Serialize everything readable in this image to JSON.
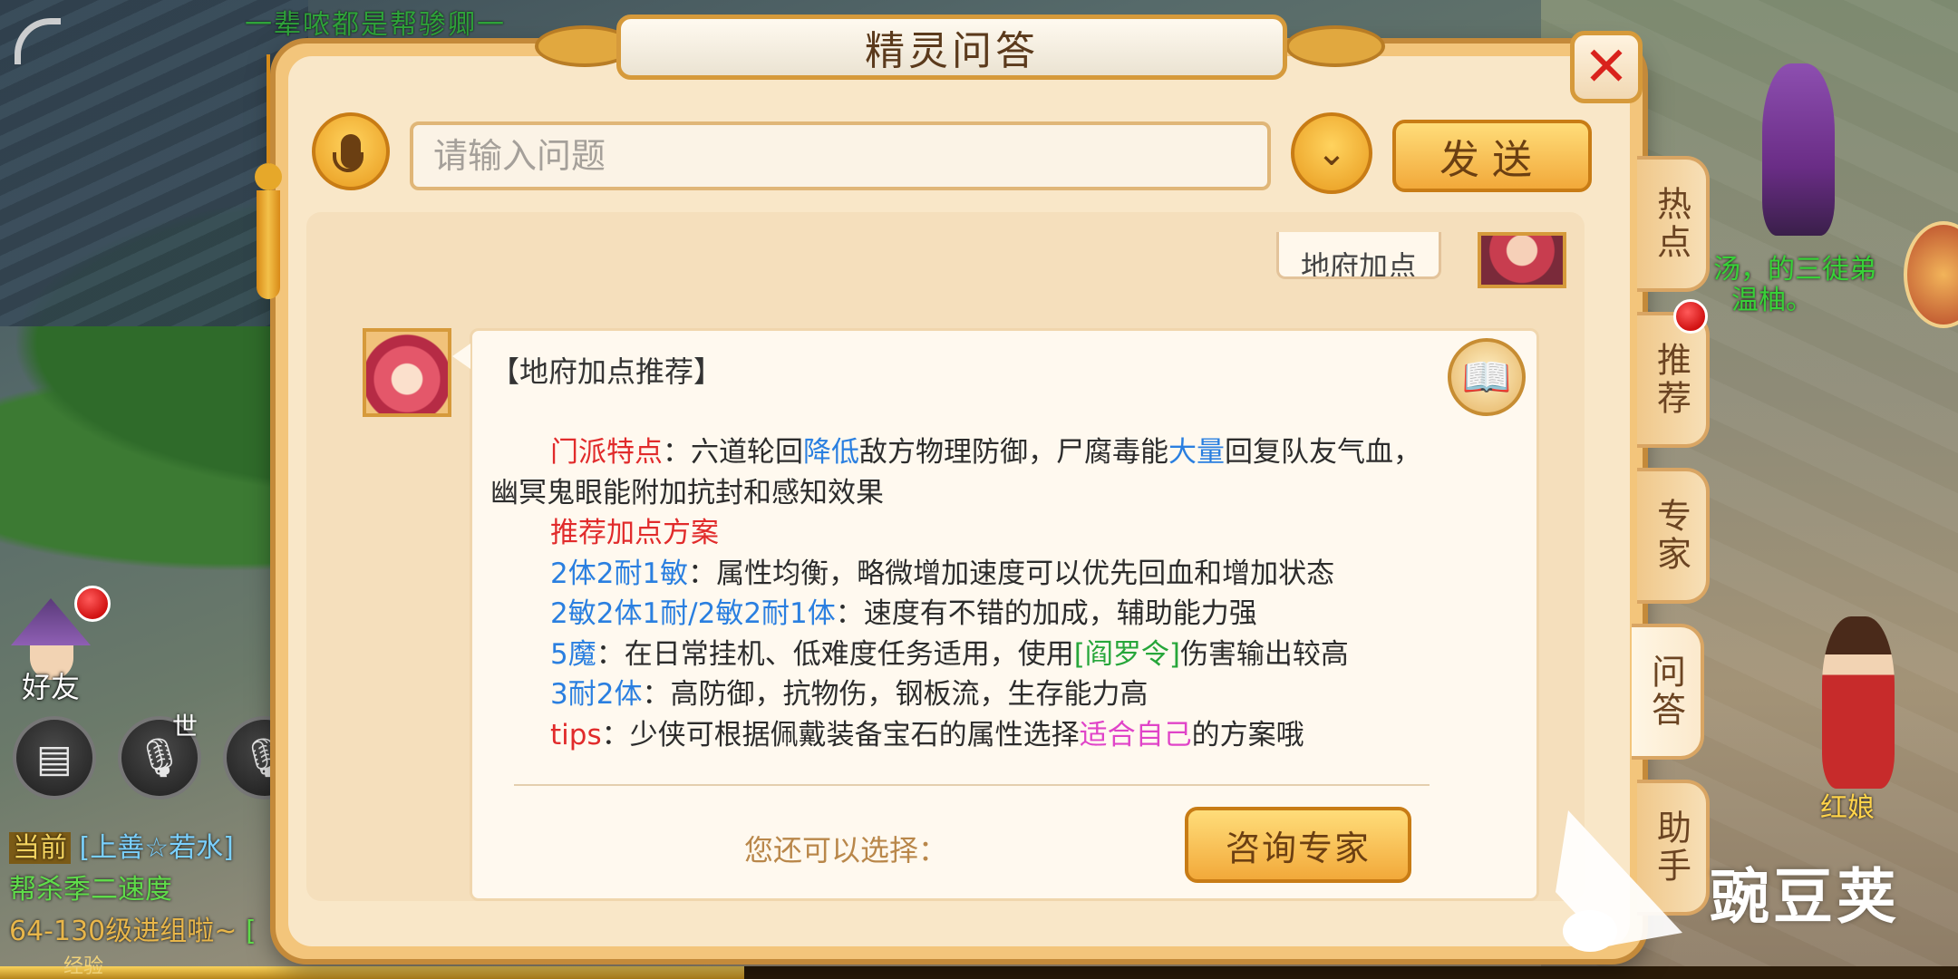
{
  "background": {
    "top_banner": "一辈哝都是帮骖卿一",
    "right_npc_text_1": "汤，的三徒弟",
    "right_npc_text_2": "温柚。",
    "npc_name": "红娘",
    "friend_label": "好友",
    "world_tag": "世",
    "chat": {
      "channel": "当前",
      "player": "[上善☆若水]",
      "line2": "帮杀季二速度",
      "line3": "64-130级进组啦~",
      "line3_tail": "[",
      "exp_label": "经验"
    }
  },
  "dialog": {
    "title": "精灵问答",
    "close_label": "✕",
    "search": {
      "placeholder": "请输入问题",
      "value": ""
    },
    "send_label": "发送",
    "user_message": "地府加点",
    "answer": {
      "title": "【地府加点推荐】",
      "sect_label": "门派特点",
      "sect_p1": "：六道轮回",
      "sect_hl1": "降低",
      "sect_p2": "敌方物理防御，尸腐毒能",
      "sect_hl2": "大量",
      "sect_p3": "回复队友气血，",
      "sect_line2": "幽冥鬼眼能附加抗封和感知效果",
      "plan_label": "推荐加点方案",
      "plans": [
        {
          "name": "2体2耐1敏",
          "desc": "：属性均衡，略微增加速度可以优先回血和增加状态"
        },
        {
          "name": "2敏2体1耐/2敏2耐1体",
          "desc": "：速度有不错的加成，辅助能力强"
        },
        {
          "name": "5魔",
          "desc_a": "：在日常挂机、低难度任务适用，使用",
          "item": "[阎罗令]",
          "desc_b": "伤害输出较高"
        },
        {
          "name": "3耐2体",
          "desc": "：高防御，抗物伤，钢板流，生存能力高"
        }
      ],
      "tips_label": "tips",
      "tips_a": "：少侠可根据佩戴装备宝石的属性选择",
      "tips_hl": "适合自己",
      "tips_b": "的方案哦"
    },
    "choose_label": "您还可以选择：",
    "consult_label": "咨询专家"
  },
  "side_tabs": [
    "热点",
    "推荐",
    "专家",
    "问答",
    "助手"
  ],
  "watermark": "豌豆荚",
  "colors": {
    "highlight_red": "#e12b2b",
    "highlight_blue": "#2a7fe0",
    "highlight_green": "#26a63a",
    "highlight_pink": "#e044c8",
    "button_gold": "#f2a93a"
  },
  "icons": [
    "back-arrow-icon",
    "mic-icon",
    "chevron-down-icon",
    "close-icon",
    "book-icon",
    "chat-bubble-icon",
    "voice-icon"
  ]
}
